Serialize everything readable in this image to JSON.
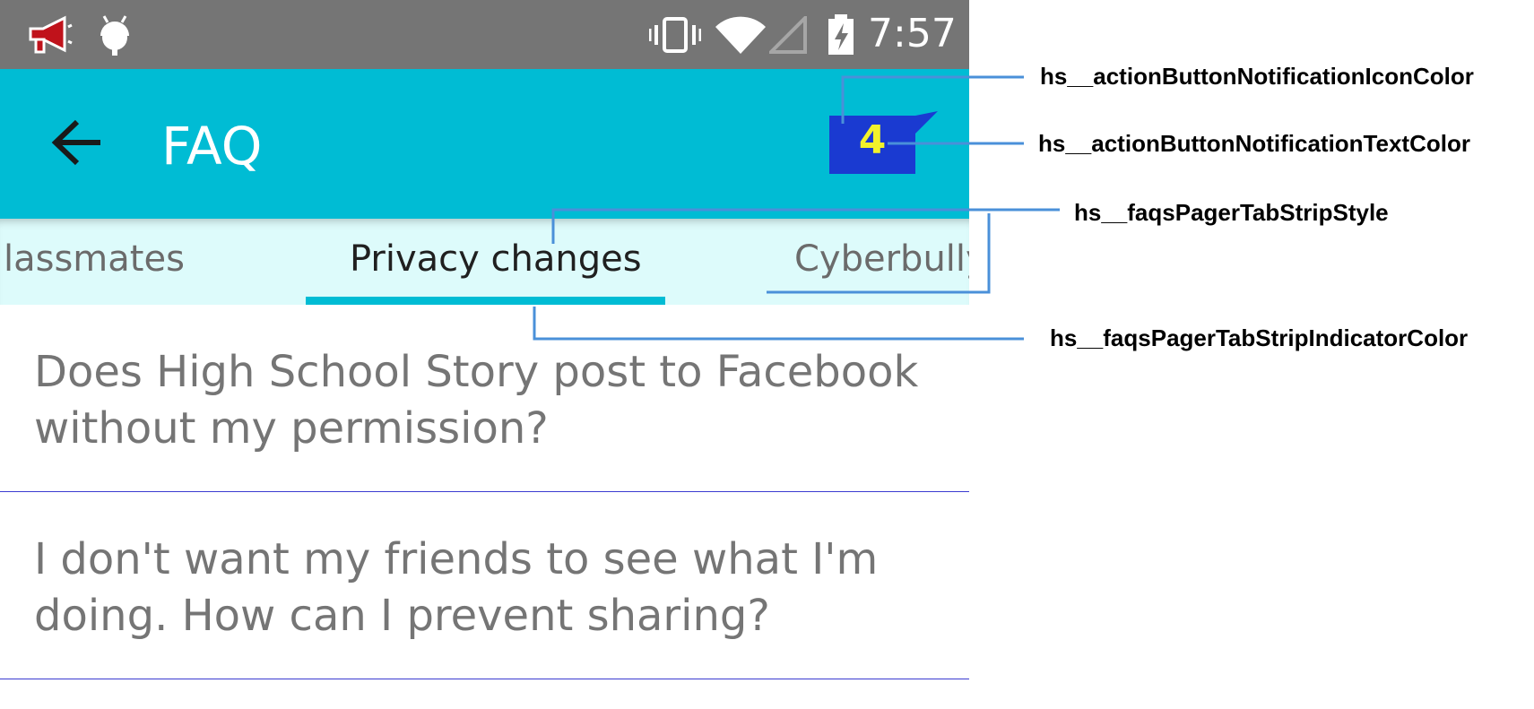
{
  "status_bar": {
    "time": "7:57",
    "left_icons": [
      "megaphone-icon",
      "android-icon"
    ],
    "right_icons": [
      "vibrate-icon",
      "wifi-icon",
      "cell-signal-icon",
      "battery-charging-icon"
    ]
  },
  "action_bar": {
    "title": "FAQ",
    "notification_count": "4",
    "colors": {
      "background": "#00bcd4",
      "notification_icon": "#1a3ad1",
      "notification_text": "#f2f22b"
    }
  },
  "tabs": {
    "items": [
      {
        "label": "lassmates"
      },
      {
        "label": "Privacy changes",
        "active": true
      },
      {
        "label": "Cyberbully"
      }
    ],
    "colors": {
      "strip_background": "#ddfbfb",
      "indicator": "#00bcd4"
    }
  },
  "faqs": [
    {
      "question": "Does High School Story post to Facebook without my permission?"
    },
    {
      "question": "I don't want my friends to see what I'm doing. How can I prevent sharing?"
    }
  ],
  "annotations": {
    "notification_icon_color": "hs__actionButtonNotificationIconColor",
    "notification_text_color": "hs__actionButtonNotificationTextColor",
    "tab_strip_style": "hs__faqsPagerTabStripStyle",
    "tab_strip_indicator_color": "hs__faqsPagerTabStripIndicatorColor",
    "line_color": "#4a90d9"
  }
}
